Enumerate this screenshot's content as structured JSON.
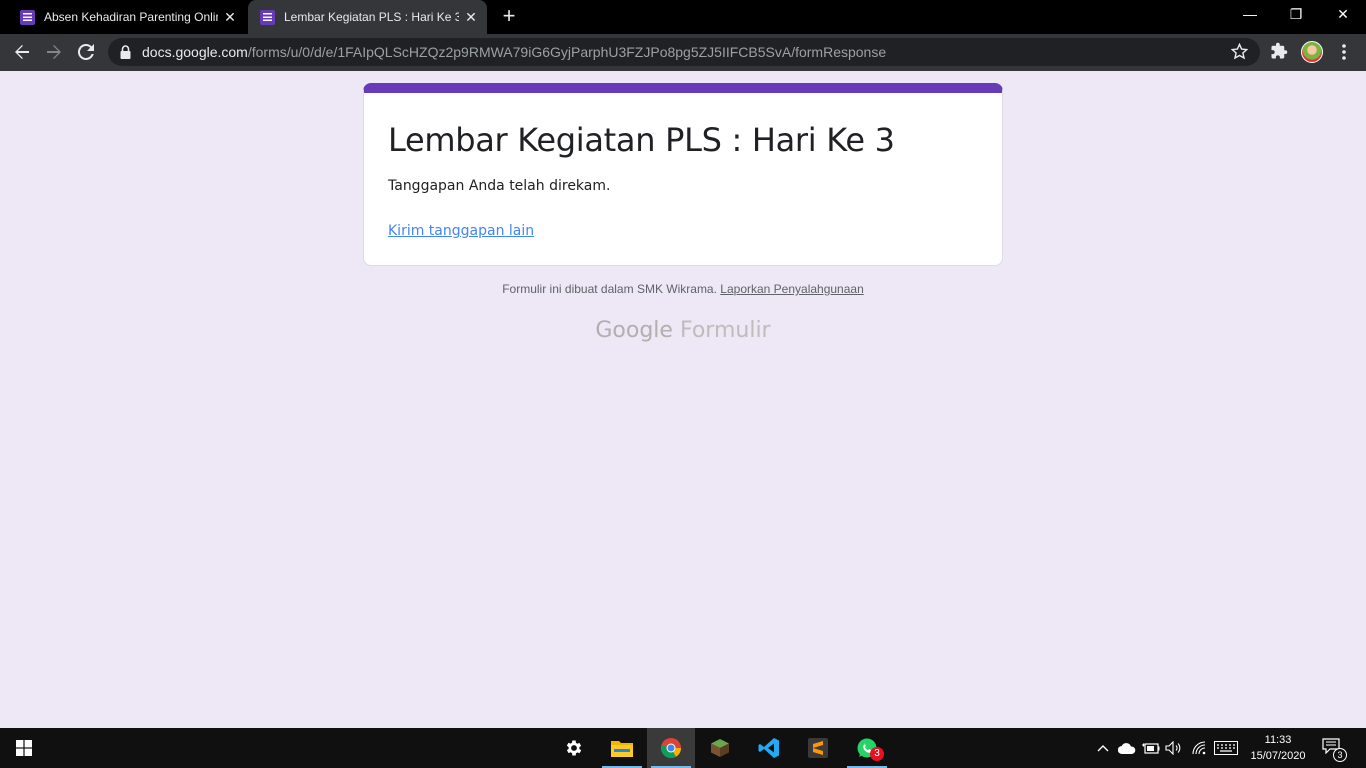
{
  "browser": {
    "tabs": [
      {
        "label": "Absen Kehadiran Parenting Onlin",
        "active": false
      },
      {
        "label": "Lembar Kegiatan PLS : Hari Ke 3",
        "active": true
      }
    ],
    "close_glyph": "✕",
    "new_tab_glyph": "+",
    "window_controls": {
      "minimize": "—",
      "restore": "❐",
      "close": "✕"
    },
    "url_host": "docs.google.com",
    "url_path": "/forms/u/0/d/e/1FAIpQLScHZQz2p9RMWA79iG6GyjParphU3FZJPo8pg5ZJ5IIFCB5SvA/formResponse"
  },
  "form": {
    "title": "Lembar Kegiatan PLS : Hari Ke 3",
    "confirmation": "Tanggapan Anda telah direkam.",
    "another_response_link": "Kirim tanggapan lain",
    "accent_color": "#673ab7"
  },
  "footer": {
    "text": "Formulir ini dibuat dalam SMK Wikrama.",
    "abuse_link": "Laporkan Penyalahgunaan",
    "brand_google": "Google",
    "brand_product": "Formulir"
  },
  "taskbar": {
    "apps": [
      "settings-icon",
      "file-explorer-icon",
      "chrome-icon",
      "minecraft-icon",
      "vscode-icon",
      "sublime-text-icon",
      "whatsapp-icon"
    ],
    "whatsapp_badge": "3",
    "clock_time": "11:33",
    "clock_date": "15/07/2020",
    "notification_count": "3"
  }
}
